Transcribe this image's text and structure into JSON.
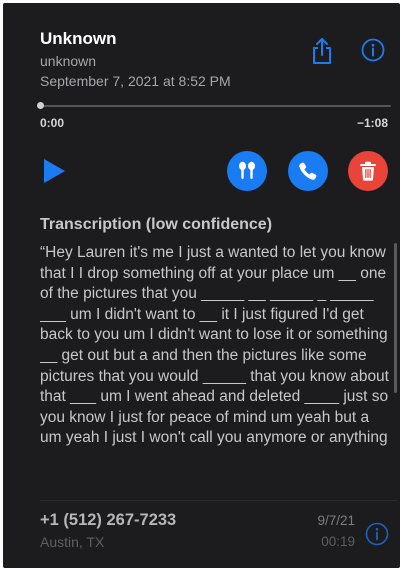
{
  "header": {
    "title": "Unknown",
    "subtitle": "unknown",
    "datetime": "September 7, 2021 at 8:52 PM",
    "share_icon": "share-icon",
    "info_icon": "info-circle-icon"
  },
  "player": {
    "position": "0:00",
    "remaining": "−1:08",
    "progress": 0,
    "play_icon": "play-icon",
    "actions": {
      "speaker_icon": "airpods-icon",
      "call_icon": "phone-icon",
      "delete_icon": "trash-icon"
    }
  },
  "transcription": {
    "title": "Transcription (low confidence)",
    "text": "“Hey Lauren it's me I just a wanted to let you know that I I drop something off at your place um __ one of the pictures that you _____ __ _____ _ _____ ___ um I didn't want to __ it I just figured I'd get back to you um I didn't want to lose it or something __ get out but a and then the pictures like some pictures that you would _____ that you know about that ___ um I went ahead and deleted ____ just so you know I just for peace of mind um yeah but a um yeah I just I won't call you anymore or anything"
  },
  "list_row": {
    "phone": "+1 (512) 267-7233",
    "location": "Austin, TX",
    "date": "9/7/21",
    "duration": "00:19",
    "info_icon": "info-circle-icon"
  },
  "colors": {
    "background": "#1c1c1e",
    "accent_blue": "#1a7cf2",
    "delete_red": "#e8443a"
  }
}
